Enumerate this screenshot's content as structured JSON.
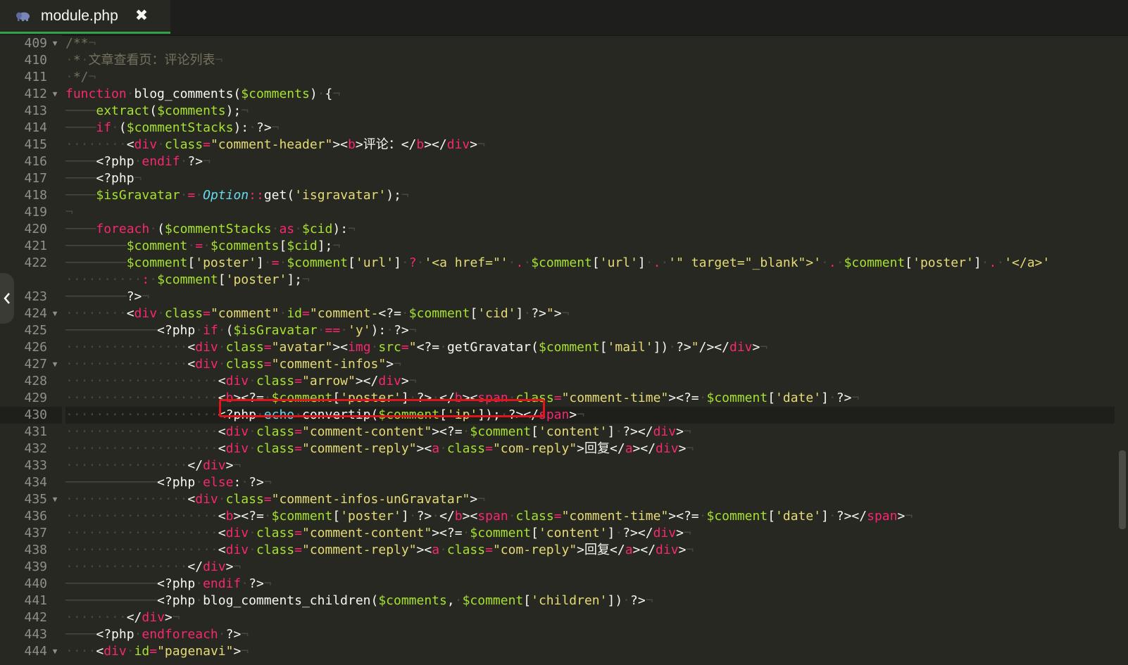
{
  "tab": {
    "title": "module.php",
    "close_glyph": "✖"
  },
  "editor": {
    "active_line": 430,
    "highlighted_line": 430,
    "lines": [
      {
        "n": "409",
        "fold": true,
        "html": "<span class=\"c\">/**</span><span class=\"pil\">¬</span>"
      },
      {
        "n": "410",
        "fold": false,
        "html": "<span class=\"c\"><span class=\"ind\">·</span>*<span class=\"ind\">·</span>文章查看页：评论列表</span><span class=\"pil\">¬</span>"
      },
      {
        "n": "411",
        "fold": false,
        "html": "<span class=\"c\"><span class=\"ind\">·</span>*/</span><span class=\"pil\">¬</span>"
      },
      {
        "n": "412",
        "fold": true,
        "html": "<span class=\"k\">function</span><span class=\"ind\">·</span><span class=\"p\">blog_comments(</span><span class=\"v\">$comments</span><span class=\"p\">)</span><span class=\"ind\">·</span><span class=\"p\">{</span><span class=\"pil\">¬</span>"
      },
      {
        "n": "413",
        "fold": false,
        "html": "<span class=\"ind\">────</span><span class=\"v\">extract</span><span class=\"p\">(</span><span class=\"v\">$comments</span><span class=\"p\">);</span><span class=\"pil\">¬</span>"
      },
      {
        "n": "414",
        "fold": false,
        "html": "<span class=\"ind\">────</span><span class=\"k\">if</span><span class=\"ind\">·</span><span class=\"p\">(</span><span class=\"v\">$commentStacks</span><span class=\"p\">):</span><span class=\"ind\">·</span><span class=\"p\">?&gt;</span><span class=\"pil\">¬</span>"
      },
      {
        "n": "415",
        "fold": false,
        "html": "<span class=\"ind\">········</span><span class=\"p\">&lt;</span><span class=\"t\">div</span><span class=\"ind\">·</span><span class=\"a\">class</span><span class=\"o\">=</span><span class=\"s\">\"comment-header\"</span><span class=\"p\">&gt;&lt;</span><span class=\"t\">b</span><span class=\"p\">&gt;评论：&lt;/</span><span class=\"t\">b</span><span class=\"p\">&gt;&lt;/</span><span class=\"t\">div</span><span class=\"p\">&gt;</span><span class=\"pil\">¬</span>"
      },
      {
        "n": "416",
        "fold": false,
        "html": "<span class=\"ind\">────</span><span class=\"p\">&lt;?php</span><span class=\"ind\">·</span><span class=\"k\">endif</span><span class=\"ind\">·</span><span class=\"p\">?&gt;</span><span class=\"pil\">¬</span>"
      },
      {
        "n": "417",
        "fold": false,
        "html": "<span class=\"ind\">────</span><span class=\"p\">&lt;?php</span><span class=\"pil\">¬</span>"
      },
      {
        "n": "418",
        "fold": false,
        "html": "<span class=\"ind\">────</span><span class=\"v\">$isGravatar</span><span class=\"ind\">·</span><span class=\"o\">=</span><span class=\"ind\">·</span><span class=\"b\">Option</span><span class=\"o\">::</span><span class=\"p\">get(</span><span class=\"s\">'isgravatar'</span><span class=\"p\">);</span><span class=\"pil\">¬</span>"
      },
      {
        "n": "419",
        "fold": false,
        "html": "<span class=\"pil\">¬</span>"
      },
      {
        "n": "420",
        "fold": false,
        "html": "<span class=\"ind\">────</span><span class=\"k\">foreach</span><span class=\"ind\">·</span><span class=\"p\">(</span><span class=\"v\">$commentStacks</span><span class=\"ind\">·</span><span class=\"k\">as</span><span class=\"ind\">·</span><span class=\"v\">$cid</span><span class=\"p\">):</span><span class=\"pil\">¬</span>"
      },
      {
        "n": "421",
        "fold": false,
        "html": "<span class=\"ind\">────────</span><span class=\"v\">$comment</span><span class=\"ind\">·</span><span class=\"o\">=</span><span class=\"ind\">·</span><span class=\"v\">$comments</span><span class=\"p\">[</span><span class=\"v\">$cid</span><span class=\"p\">];</span><span class=\"pil\">¬</span>"
      },
      {
        "n": "422",
        "fold": false,
        "html": "<span class=\"ind\">────────</span><span class=\"v\">$comment</span><span class=\"p\">[</span><span class=\"s\">'poster'</span><span class=\"p\">]</span><span class=\"ind\">·</span><span class=\"o\">=</span><span class=\"ind\">·</span><span class=\"v\">$comment</span><span class=\"p\">[</span><span class=\"s\">'url'</span><span class=\"p\">]</span><span class=\"ind\">·</span><span class=\"o\">?</span><span class=\"ind\">·</span><span class=\"s\">'&lt;a href=\"'</span><span class=\"ind\">·</span><span class=\"o\">.</span><span class=\"ind\">·</span><span class=\"v\">$comment</span><span class=\"p\">[</span><span class=\"s\">'url'</span><span class=\"p\">]</span><span class=\"ind\">·</span><span class=\"o\">.</span><span class=\"ind\">·</span><span class=\"s\">'\" target=\"_blank\"&gt;'</span><span class=\"ind\">·</span><span class=\"o\">.</span><span class=\"ind\">·</span><span class=\"v\">$comment</span><span class=\"p\">[</span><span class=\"s\">'poster'</span><span class=\"p\">]</span><span class=\"ind\">·</span><span class=\"o\">.</span><span class=\"ind\">·</span><span class=\"s\">'&lt;/a&gt;'</span>"
      },
      {
        "n": "",
        "fold": false,
        "html": "<span class=\"ind\">··········</span><span class=\"o\">:</span><span class=\"ind\">·</span><span class=\"v\">$comment</span><span class=\"p\">[</span><span class=\"s\">'poster'</span><span class=\"p\">];</span><span class=\"pil\">¬</span>"
      },
      {
        "n": "423",
        "fold": false,
        "html": "<span class=\"ind\">────────</span><span class=\"p\">?&gt;</span><span class=\"pil\">¬</span>"
      },
      {
        "n": "424",
        "fold": true,
        "html": "<span class=\"ind\">········</span><span class=\"p\">&lt;</span><span class=\"t\">div</span><span class=\"ind\">·</span><span class=\"a\">class</span><span class=\"o\">=</span><span class=\"s\">\"comment\"</span><span class=\"ind\">·</span><span class=\"a\">id</span><span class=\"o\">=</span><span class=\"s\">\"comment-</span><span class=\"p\">&lt;?=</span><span class=\"ind\">·</span><span class=\"v\">$comment</span><span class=\"p\">[</span><span class=\"s\">'cid'</span><span class=\"p\">]</span><span class=\"ind\">·</span><span class=\"p\">?&gt;</span><span class=\"s\">\"</span><span class=\"p\">&gt;</span><span class=\"pil\">¬</span>"
      },
      {
        "n": "425",
        "fold": false,
        "html": "<span class=\"ind\">────────────</span><span class=\"p\">&lt;?php</span><span class=\"ind\">·</span><span class=\"k\">if</span><span class=\"ind\">·</span><span class=\"p\">(</span><span class=\"v\">$isGravatar</span><span class=\"ind\">·</span><span class=\"o\">==</span><span class=\"ind\">·</span><span class=\"s\">'y'</span><span class=\"p\">):</span><span class=\"ind\">·</span><span class=\"p\">?&gt;</span><span class=\"pil\">¬</span>"
      },
      {
        "n": "426",
        "fold": false,
        "html": "<span class=\"ind\">················</span><span class=\"p\">&lt;</span><span class=\"t\">div</span><span class=\"ind\">·</span><span class=\"a\">class</span><span class=\"o\">=</span><span class=\"s\">\"avatar\"</span><span class=\"p\">&gt;&lt;</span><span class=\"t\">img</span><span class=\"ind\">·</span><span class=\"a\">src</span><span class=\"o\">=</span><span class=\"s\">\"</span><span class=\"p\">&lt;?=</span><span class=\"ind\">·</span><span class=\"p\">getGravatar(</span><span class=\"v\">$comment</span><span class=\"p\">[</span><span class=\"s\">'mail'</span><span class=\"p\">])</span><span class=\"ind\">·</span><span class=\"p\">?&gt;</span><span class=\"s\">\"</span><span class=\"p\">/&gt;&lt;/</span><span class=\"t\">div</span><span class=\"p\">&gt;</span><span class=\"pil\">¬</span>"
      },
      {
        "n": "427",
        "fold": true,
        "html": "<span class=\"ind\">················</span><span class=\"p\">&lt;</span><span class=\"t\">div</span><span class=\"ind\">·</span><span class=\"a\">class</span><span class=\"o\">=</span><span class=\"s\">\"comment-infos\"</span><span class=\"p\">&gt;</span><span class=\"pil\">¬</span>"
      },
      {
        "n": "428",
        "fold": false,
        "html": "<span class=\"ind\">····················</span><span class=\"p\">&lt;</span><span class=\"t\">div</span><span class=\"ind\">·</span><span class=\"a\">class</span><span class=\"o\">=</span><span class=\"s\">\"arrow\"</span><span class=\"p\">&gt;&lt;/</span><span class=\"t\">div</span><span class=\"p\">&gt;</span><span class=\"pil\">¬</span>"
      },
      {
        "n": "429",
        "fold": false,
        "html": "<span class=\"ind\">····················</span><span class=\"p\">&lt;</span><span class=\"t\">b</span><span class=\"p\">&gt;&lt;?=</span><span class=\"ind\">·</span><span class=\"v\">$comment</span><span class=\"p\">[</span><span class=\"s\">'poster'</span><span class=\"p\">]</span><span class=\"ind\">·</span><span class=\"p\">?&gt;</span><span class=\"ind\">·</span><span class=\"p\">&lt;/</span><span class=\"t\">b</span><span class=\"p\">&gt;&lt;</span><span class=\"t\">span</span><span class=\"ind\">·</span><span class=\"a\">class</span><span class=\"o\">=</span><span class=\"s\">\"comment-time\"</span><span class=\"p\">&gt;&lt;?=</span><span class=\"ind\">·</span><span class=\"v\">$comment</span><span class=\"p\">[</span><span class=\"s\">'date'</span><span class=\"p\">]</span><span class=\"ind\">·</span><span class=\"p\">?&gt;</span><span class=\"pil\">¬</span>"
      },
      {
        "n": "430",
        "fold": false,
        "html": "<span class=\"ind\">····················</span><span class=\"p\">&lt;?php</span><span class=\"ind\">·</span><span class=\"e\">echo</span><span class=\"ind\">·</span><span class=\"p\">convertip(</span><span class=\"v\">$comment</span><span class=\"p\">[</span><span class=\"s\">'ip'</span><span class=\"p\">]);</span><span class=\"ind\">·</span><span class=\"p\">?&gt;&lt;/</span><span class=\"t\">span</span><span class=\"p\">&gt;</span><span class=\"pil\">¬</span>"
      },
      {
        "n": "431",
        "fold": false,
        "html": "<span class=\"ind\">····················</span><span class=\"p\">&lt;</span><span class=\"t\">div</span><span class=\"ind\">·</span><span class=\"a\">class</span><span class=\"o\">=</span><span class=\"s\">\"comment-content\"</span><span class=\"p\">&gt;&lt;?=</span><span class=\"ind\">·</span><span class=\"v\">$comment</span><span class=\"p\">[</span><span class=\"s\">'content'</span><span class=\"p\">]</span><span class=\"ind\">·</span><span class=\"p\">?&gt;&lt;/</span><span class=\"t\">div</span><span class=\"p\">&gt;</span><span class=\"pil\">¬</span>"
      },
      {
        "n": "432",
        "fold": false,
        "html": "<span class=\"ind\">····················</span><span class=\"p\">&lt;</span><span class=\"t\">div</span><span class=\"ind\">·</span><span class=\"a\">class</span><span class=\"o\">=</span><span class=\"s\">\"comment-reply\"</span><span class=\"p\">&gt;&lt;</span><span class=\"t\">a</span><span class=\"ind\">·</span><span class=\"a\">class</span><span class=\"o\">=</span><span class=\"s\">\"com-reply\"</span><span class=\"p\">&gt;回复&lt;/</span><span class=\"t\">a</span><span class=\"p\">&gt;&lt;/</span><span class=\"t\">div</span><span class=\"p\">&gt;</span><span class=\"pil\">¬</span>"
      },
      {
        "n": "433",
        "fold": false,
        "html": "<span class=\"ind\">················</span><span class=\"p\">&lt;/</span><span class=\"t\">div</span><span class=\"p\">&gt;</span><span class=\"pil\">¬</span>"
      },
      {
        "n": "434",
        "fold": false,
        "html": "<span class=\"ind\">────────────</span><span class=\"p\">&lt;?php</span><span class=\"ind\">·</span><span class=\"k\">else</span><span class=\"p\">:</span><span class=\"ind\">·</span><span class=\"p\">?&gt;</span><span class=\"pil\">¬</span>"
      },
      {
        "n": "435",
        "fold": true,
        "html": "<span class=\"ind\">················</span><span class=\"p\">&lt;</span><span class=\"t\">div</span><span class=\"ind\">·</span><span class=\"a\">class</span><span class=\"o\">=</span><span class=\"s\">\"comment-infos-unGravatar\"</span><span class=\"p\">&gt;</span><span class=\"pil\">¬</span>"
      },
      {
        "n": "436",
        "fold": false,
        "html": "<span class=\"ind\">····················</span><span class=\"p\">&lt;</span><span class=\"t\">b</span><span class=\"p\">&gt;&lt;?=</span><span class=\"ind\">·</span><span class=\"v\">$comment</span><span class=\"p\">[</span><span class=\"s\">'poster'</span><span class=\"p\">]</span><span class=\"ind\">·</span><span class=\"p\">?&gt;</span><span class=\"ind\">·</span><span class=\"p\">&lt;/</span><span class=\"t\">b</span><span class=\"p\">&gt;&lt;</span><span class=\"t\">span</span><span class=\"ind\">·</span><span class=\"a\">class</span><span class=\"o\">=</span><span class=\"s\">\"comment-time\"</span><span class=\"p\">&gt;&lt;?=</span><span class=\"ind\">·</span><span class=\"v\">$comment</span><span class=\"p\">[</span><span class=\"s\">'date'</span><span class=\"p\">]</span><span class=\"ind\">·</span><span class=\"p\">?&gt;&lt;/</span><span class=\"t\">span</span><span class=\"p\">&gt;</span><span class=\"pil\">¬</span>"
      },
      {
        "n": "437",
        "fold": false,
        "html": "<span class=\"ind\">····················</span><span class=\"p\">&lt;</span><span class=\"t\">div</span><span class=\"ind\">·</span><span class=\"a\">class</span><span class=\"o\">=</span><span class=\"s\">\"comment-content\"</span><span class=\"p\">&gt;&lt;?=</span><span class=\"ind\">·</span><span class=\"v\">$comment</span><span class=\"p\">[</span><span class=\"s\">'content'</span><span class=\"p\">]</span><span class=\"ind\">·</span><span class=\"p\">?&gt;&lt;/</span><span class=\"t\">div</span><span class=\"p\">&gt;</span><span class=\"pil\">¬</span>"
      },
      {
        "n": "438",
        "fold": false,
        "html": "<span class=\"ind\">····················</span><span class=\"p\">&lt;</span><span class=\"t\">div</span><span class=\"ind\">·</span><span class=\"a\">class</span><span class=\"o\">=</span><span class=\"s\">\"comment-reply\"</span><span class=\"p\">&gt;&lt;</span><span class=\"t\">a</span><span class=\"ind\">·</span><span class=\"a\">class</span><span class=\"o\">=</span><span class=\"s\">\"com-reply\"</span><span class=\"p\">&gt;回复&lt;/</span><span class=\"t\">a</span><span class=\"p\">&gt;&lt;/</span><span class=\"t\">div</span><span class=\"p\">&gt;</span><span class=\"pil\">¬</span>"
      },
      {
        "n": "439",
        "fold": false,
        "html": "<span class=\"ind\">················</span><span class=\"p\">&lt;/</span><span class=\"t\">div</span><span class=\"p\">&gt;</span><span class=\"pil\">¬</span>"
      },
      {
        "n": "440",
        "fold": false,
        "html": "<span class=\"ind\">────────────</span><span class=\"p\">&lt;?php</span><span class=\"ind\">·</span><span class=\"k\">endif</span><span class=\"ind\">·</span><span class=\"p\">?&gt;</span><span class=\"pil\">¬</span>"
      },
      {
        "n": "441",
        "fold": false,
        "html": "<span class=\"ind\">────────────</span><span class=\"p\">&lt;?php</span><span class=\"ind\">·</span><span class=\"p\">blog_comments_children(</span><span class=\"v\">$comments</span><span class=\"p\">,</span><span class=\"ind\">·</span><span class=\"v\">$comment</span><span class=\"p\">[</span><span class=\"s\">'children'</span><span class=\"p\">])</span><span class=\"ind\">·</span><span class=\"p\">?&gt;</span><span class=\"pil\">¬</span>"
      },
      {
        "n": "442",
        "fold": false,
        "html": "<span class=\"ind\">········</span><span class=\"p\">&lt;/</span><span class=\"t\">div</span><span class=\"p\">&gt;</span><span class=\"pil\">¬</span>"
      },
      {
        "n": "443",
        "fold": false,
        "html": "<span class=\"ind\">────</span><span class=\"p\">&lt;?php</span><span class=\"ind\">·</span><span class=\"k\">endforeach</span><span class=\"ind\">·</span><span class=\"p\">?&gt;</span><span class=\"pil\">¬</span>"
      },
      {
        "n": "444",
        "fold": true,
        "html": "<span class=\"ind\">····</span><span class=\"p\">&lt;</span><span class=\"t\">div</span><span class=\"ind\">·</span><span class=\"a\">id</span><span class=\"o\">=</span><span class=\"s\">\"pagenavi\"</span><span class=\"p\">&gt;</span><span class=\"pil\">¬</span>"
      }
    ]
  },
  "colors": {
    "background": "#272822",
    "keyword": "#f92672",
    "string": "#e6db74",
    "variable": "#a6e22e",
    "comment": "#75715e",
    "highlight_box": "#e0141b",
    "tab_underline": "#2fa24a"
  },
  "icons": {
    "tab_icon": "php-elephant-icon",
    "tab_close": "close-icon",
    "side_toggle": "chevron-left-icon"
  }
}
